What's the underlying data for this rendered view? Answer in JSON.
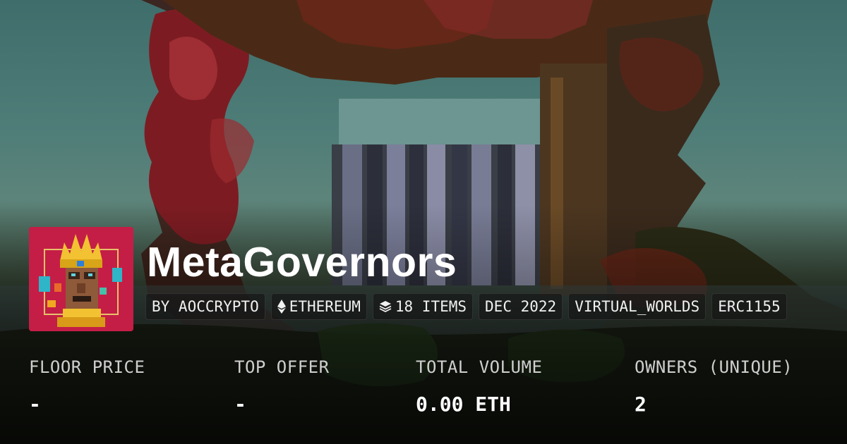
{
  "collection": {
    "name": "MetaGovernors",
    "avatar_icon": "crowned-pixel-figure-icon"
  },
  "tags": [
    {
      "label": "BY AOCCRYPTO",
      "icon": ""
    },
    {
      "label": "ETHEREUM",
      "icon": "ethereum-icon"
    },
    {
      "label": "18 ITEMS",
      "icon": "layers-icon"
    },
    {
      "label": "DEC 2022",
      "icon": ""
    },
    {
      "label": "VIRTUAL_WORLDS",
      "icon": ""
    },
    {
      "label": "ERC1155",
      "icon": ""
    }
  ],
  "stats": [
    {
      "label": "FLOOR PRICE",
      "value": "-"
    },
    {
      "label": "TOP OFFER",
      "value": "-"
    },
    {
      "label": "TOTAL VOLUME",
      "value": "0.00 ETH"
    },
    {
      "label": "OWNERS (UNIQUE)",
      "value": "2"
    }
  ],
  "colors": {
    "avatar_background": "#c41e46",
    "text": "#ffffff",
    "label_text": "#cfcfcf",
    "tag_background": "#141414"
  }
}
